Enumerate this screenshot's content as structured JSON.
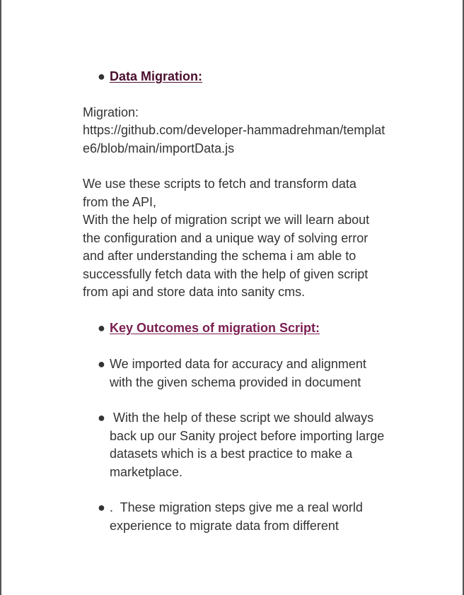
{
  "section1": {
    "heading": "Data Migration:",
    "heading_color": "#4a0f2e"
  },
  "migration_para": {
    "lines": [
      "Migration:",
      "https://github.com/developer-hammadrehman/templat",
      "e6/blob/main/importData.js"
    ]
  },
  "description_para": {
    "lines": [
      "We use these  scripts to fetch and transform data",
      "from the API,",
      "With the help of migration script we will learn about",
      "the configuration and a unique way of solving error",
      "and after understanding the schema i am able to",
      "successfully fetch data with the help of given script",
      "from api and store data into sanity cms."
    ]
  },
  "section2": {
    "heading": "Key Outcomes of migration Script:",
    "heading_color": "#7a1e50"
  },
  "bullets": [
    {
      "lines": [
        "We imported data for accuracy and alignment",
        "with the given  schema provided in document"
      ]
    },
    {
      "lines": [
        " With the help of these script we should always",
        "back up our Sanity project before importing large",
        "datasets which is a best practice to make a",
        "marketplace."
      ]
    },
    {
      "lines": [
        ".  These migration steps give me a real world",
        "experience to migrate data from different"
      ]
    }
  ],
  "bullet_glyph": "●",
  "text_color": "#333333"
}
